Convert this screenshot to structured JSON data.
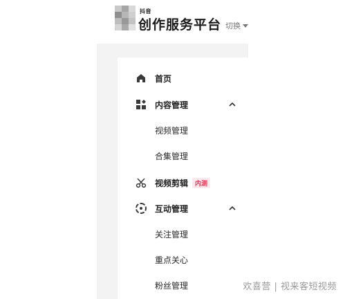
{
  "header": {
    "brand_small": "抖音",
    "title": "创作服务平台",
    "switch_label": "切换"
  },
  "sidebar": {
    "home": "首页",
    "content_manage": {
      "label": "内容管理",
      "children": [
        "视频管理",
        "合集管理"
      ]
    },
    "video_edit": {
      "label": "视频剪辑",
      "badge": "内测"
    },
    "interaction_manage": {
      "label": "互动管理",
      "children": [
        "关注管理",
        "重点关心",
        "粉丝管理"
      ]
    }
  },
  "watermark": "欢喜营 | 视来客短视频",
  "colors": {
    "badge_text": "#e8385a",
    "badge_bg": "#fde8ee",
    "sidebar_bg": "#f3f3f4"
  }
}
